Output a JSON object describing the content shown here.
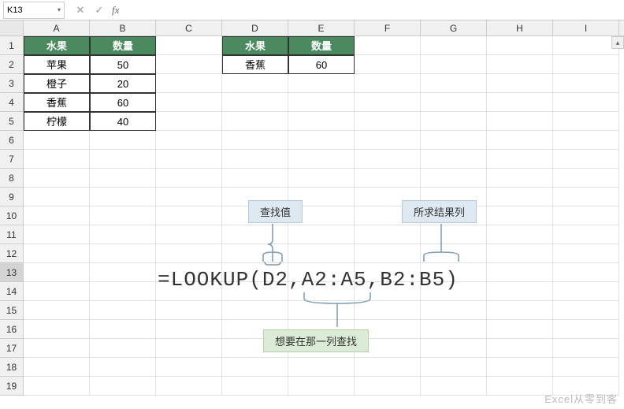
{
  "nameBox": "K13",
  "formulaBar": "",
  "columns": [
    "A",
    "B",
    "C",
    "D",
    "E",
    "F",
    "G",
    "H",
    "I"
  ],
  "rows": [
    "1",
    "2",
    "3",
    "4",
    "5",
    "6",
    "7",
    "8",
    "9",
    "10",
    "11",
    "12",
    "13",
    "14",
    "15",
    "16",
    "17",
    "18",
    "19"
  ],
  "activeRow": "13",
  "table1": {
    "headers": {
      "fruit": "水果",
      "qty": "数量"
    },
    "rows": [
      {
        "fruit": "苹果",
        "qty": "50"
      },
      {
        "fruit": "橙子",
        "qty": "20"
      },
      {
        "fruit": "香蕉",
        "qty": "60"
      },
      {
        "fruit": "柠檬",
        "qty": "40"
      }
    ]
  },
  "table2": {
    "headers": {
      "fruit": "水果",
      "qty": "数量"
    },
    "rows": [
      {
        "fruit": "香蕉",
        "qty": "60"
      }
    ]
  },
  "formula": "=LOOKUP(D2,A2:A5,B2:B5)",
  "callouts": {
    "lookup_value": "查找值",
    "result_col": "所求结果列",
    "search_col": "想要在那一列查找"
  },
  "watermark": "Excel从零到客",
  "icons": {
    "cancel": "✕",
    "confirm": "✓",
    "fx": "fx",
    "dropdown": "▾",
    "scrollUp": "▴"
  }
}
